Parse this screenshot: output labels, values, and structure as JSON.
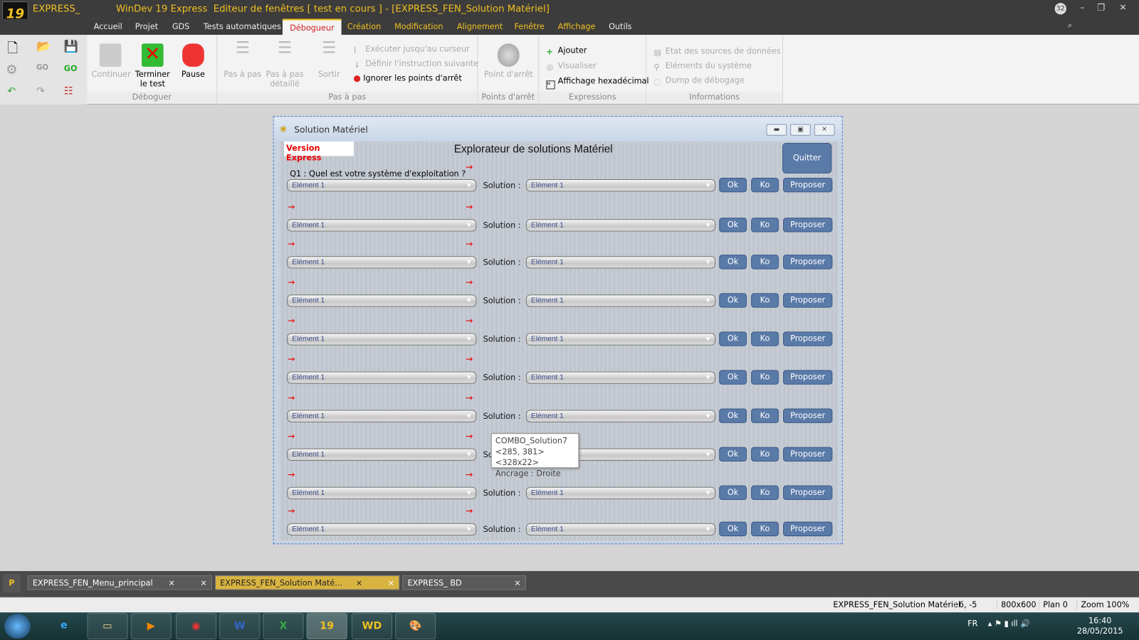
{
  "titlebar": {
    "title": "EXPRESS_            WinDev 19 Express  Editeur de fenêtres [ test en cours ] - [EXPRESS_FEN_Solution Matériel]",
    "logo": "19",
    "badge": "32"
  },
  "menu": [
    "Accueil",
    "Projet",
    "GDS",
    "Tests automatiques",
    "Débogueur",
    "Création",
    "Modification",
    "Alignement",
    "Fenêtre",
    "Affichage",
    "Outils"
  ],
  "ribbon": {
    "debug": {
      "continue": "Continuer",
      "stop": "Terminer le test",
      "pause": "Pause",
      "label": "Déboguer"
    },
    "step": {
      "step": "Pas à pas",
      "step_detail": "Pas à pas détaillé",
      "exit": "Sortir",
      "run_cursor": "Exécuter jusqu'au curseur",
      "set_next": "Définir l'instruction suivante",
      "ignore_bp": "Ignorer les points d'arrêt",
      "label": "Pas à pas"
    },
    "bp": {
      "breakpoint": "Point d'arrêt",
      "label": "Points d'arrêt"
    },
    "expr": {
      "add": "Ajouter",
      "view": "Visualiser",
      "hex": "Affichage hexadécimal",
      "label": "Expressions"
    },
    "info": {
      "sources": "Etat des sources de données",
      "system": "Eléments du système",
      "dump": "Dump de débogage",
      "label": "Informations"
    }
  },
  "window": {
    "title": "Solution Matériel",
    "version": "Version Express",
    "heading": "Explorateur de solutions Matériel",
    "quit": "Quitter",
    "question": "Q1 : Quel est votre système d'exploitation ?",
    "rows": [
      {
        "left": "Elément 1",
        "label": "Solution :",
        "right": "Elément 1",
        "ok": "Ok",
        "ko": "Ko",
        "propose": "Proposer"
      },
      {
        "left": "Elément 1",
        "label": "Solution :",
        "right": "Elément 1",
        "ok": "Ok",
        "ko": "Ko",
        "propose": "Proposer"
      },
      {
        "left": "Elément 1",
        "label": "Solution :",
        "right": "Elément 1",
        "ok": "Ok",
        "ko": "Ko",
        "propose": "Proposer"
      },
      {
        "left": "Elément 1",
        "label": "Solution :",
        "right": "Elément 1",
        "ok": "Ok",
        "ko": "Ko",
        "propose": "Proposer"
      },
      {
        "left": "Elément 1",
        "label": "Solution :",
        "right": "Elément 1",
        "ok": "Ok",
        "ko": "Ko",
        "propose": "Proposer"
      },
      {
        "left": "Elément 1",
        "label": "Solution :",
        "right": "Elément 1",
        "ok": "Ok",
        "ko": "Ko",
        "propose": "Proposer"
      },
      {
        "left": "Elément 1",
        "label": "Solution :",
        "right": "Elément 1",
        "ok": "Ok",
        "ko": "Ko",
        "propose": "Proposer"
      },
      {
        "left": "Elément 1",
        "label": "So",
        "right": "",
        "ok": "Ok",
        "ko": "Ko",
        "propose": "Proposer"
      },
      {
        "left": "Elément 1",
        "label": "Solution :",
        "right": "Elément 1",
        "ok": "Ok",
        "ko": "Ko",
        "propose": "Proposer"
      },
      {
        "left": "Elément 1",
        "label": "Solution :",
        "right": "Elément 1",
        "ok": "Ok",
        "ko": "Ko",
        "propose": "Proposer"
      }
    ]
  },
  "tooltip": {
    "name": "COMBO_Solution7",
    "pos": "<285, 381>  <328x22>",
    "anchor": "Ancrage : Droite"
  },
  "doctabs": [
    {
      "label": "EXPRESS_FEN_Menu_principal"
    },
    {
      "label": "EXPRESS_FEN_Solution Maté..."
    },
    {
      "label": "EXPRESS_           BD"
    }
  ],
  "status": {
    "window": "EXPRESS_FEN_Solution Matériel",
    "coords": "6, -5",
    "size": "800x600",
    "plan": "Plan 0",
    "zoom": "Zoom 100%"
  },
  "taskbar": {
    "lang": "FR",
    "time": "16:40",
    "date": "28/05/2015"
  },
  "colors": {
    "accent": "#f0c020",
    "button": "#5a7aa8",
    "active_tab_text": "#d02020"
  }
}
